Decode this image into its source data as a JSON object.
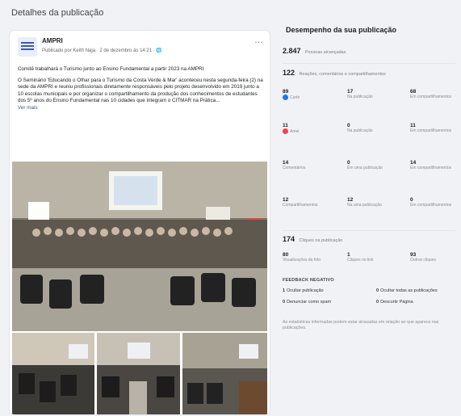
{
  "page_title": "Detalhes da publicação",
  "post": {
    "author": "AMPRI",
    "meta": "Publicado por Keith Naja · 2 de dezembro às 14:21 ·",
    "paragraph1": "Comitê trabalhará o Turismo junto ao Ensino Fundamental a partir 2023 na AMPRI",
    "paragraph2": "O Seminário 'Educando o Olhar para o Turismo da Costa Verde & Mar' aconteceu nesta segunda-feira (2) na sede da AMPRI e reuniu profissionais diretamente responsáveis pelo projeto desenvolvido em 2019 junto a 10 escolas municipais e por organizar o compartilhamento da produção dos conhecimentos de estudantes dos 5º anos do Ensino Fundamental nas 10 cidades que integram o CITMAR na Prática...",
    "see_more": "Ver mais"
  },
  "performance": {
    "title": "Desempenho da sua publicação",
    "reach_value": "2.847",
    "reach_label": "Pessoas alcançadas",
    "engagement_value": "122",
    "engagement_label": "Reações, comentários e compartilhamentos",
    "reactions": [
      {
        "num": "89",
        "label": "Curtir",
        "icon": "like"
      },
      {
        "num": "17",
        "label": "Na publicação",
        "icon": ""
      },
      {
        "num": "68",
        "label": "Em compartilhamentos",
        "icon": ""
      },
      {
        "num": "11",
        "label": "Amei",
        "icon": "love"
      },
      {
        "num": "0",
        "label": "Na publicação",
        "icon": ""
      },
      {
        "num": "11",
        "label": "Em compartilhamentos",
        "icon": ""
      },
      {
        "num": "14",
        "label": "Comentários",
        "icon": ""
      },
      {
        "num": "0",
        "label": "Em uma publicação",
        "icon": ""
      },
      {
        "num": "14",
        "label": "Em compartilhamentos",
        "icon": ""
      },
      {
        "num": "12",
        "label": "Compartilhamentos",
        "icon": ""
      },
      {
        "num": "12",
        "label": "Na uma publicação",
        "icon": ""
      },
      {
        "num": "0",
        "label": "Em compartilhamentos",
        "icon": ""
      }
    ],
    "clicks_value": "174",
    "clicks_label": "Cliques na publicação",
    "clicks": [
      {
        "num": "80",
        "label": "Visualizações da foto"
      },
      {
        "num": "1",
        "label": "Cliques no link"
      },
      {
        "num": "93",
        "label": "Outros cliques"
      }
    ],
    "negative_header": "FEEDBACK NEGATIVO",
    "negative": [
      {
        "num": "1",
        "label": "Ocultar publicação"
      },
      {
        "num": "0",
        "label": "Ocultar todas as publicações"
      },
      {
        "num": "0",
        "label": "Denunciar como spam"
      },
      {
        "num": "0",
        "label": "Descurtir Página"
      }
    ],
    "note": "As estatísticas informadas podem estar atrasadas em relação ao que aparece nas publicações."
  }
}
